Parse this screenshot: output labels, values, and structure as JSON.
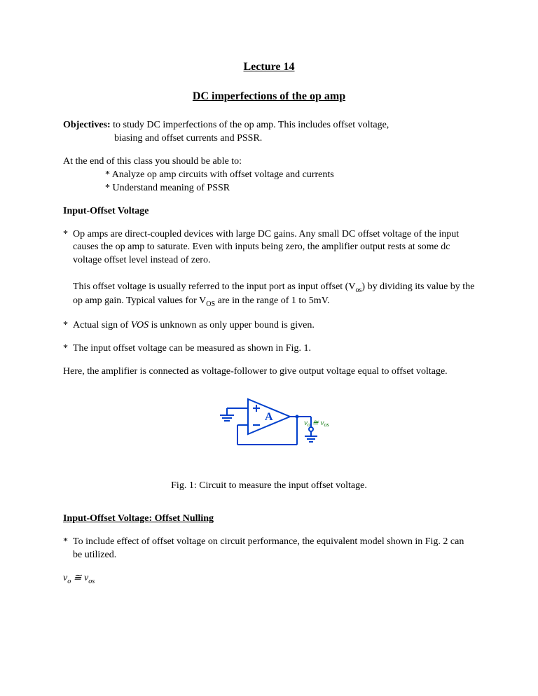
{
  "title": "Lecture 14",
  "subtitle": "DC imperfections of the op amp",
  "objectives": {
    "label": "Objectives:",
    "line1": " to study DC imperfections of the op amp. This includes offset voltage,",
    "line2": "biasing and offset currents and PSSR."
  },
  "endclass": {
    "intro": "At the end of this class you should be able to:",
    "item1": "* Analyze op amp circuits with offset voltage and currents",
    "item2": "* Understand meaning of PSSR"
  },
  "section1": {
    "heading": "Input-Offset Voltage",
    "b1": "Op amps are direct-coupled devices with large DC gains. Any small DC offset voltage of the input causes the op amp to saturate. Even with inputs being zero, the amplifier output rests at some dc voltage offset level instead of zero.",
    "b1b_pre": "This offset voltage is usually referred to the input port as input offset (V",
    "b1b_sub1": "os",
    "b1b_mid": ") by dividing its value by the op amp gain. Typical values for V",
    "b1b_sub2": "OS",
    "b1b_post": " are in the range of 1 to 5mV.",
    "b2_pre": "Actual sign of ",
    "b2_it": "VOS",
    "b2_post": " is unknown as only upper bound is given.",
    "b3": "The input offset voltage can be measured as shown in Fig. 1.",
    "para": "Here, the amplifier is connected as voltage-follower to give output voltage equal to offset voltage."
  },
  "figure1": {
    "caption": "Fig. 1: Circuit to measure the input offset voltage.",
    "amp_label": "A",
    "out_label_vo": "v",
    "out_label_vo_sub": "o",
    "out_label_approx": " ≅ ",
    "out_label_vos": "v",
    "out_label_vos_sub": "os"
  },
  "section2": {
    "heading": "Input-Offset Voltage: Offset Nulling",
    "b1": "To include effect of offset voltage on circuit performance, the equivalent model shown in Fig. 2 can be utilized."
  },
  "eq1": {
    "lhs_v": "v",
    "lhs_sub": "o",
    "approx": "  ≅  ",
    "rhs_v": "v",
    "rhs_sub": "os"
  }
}
